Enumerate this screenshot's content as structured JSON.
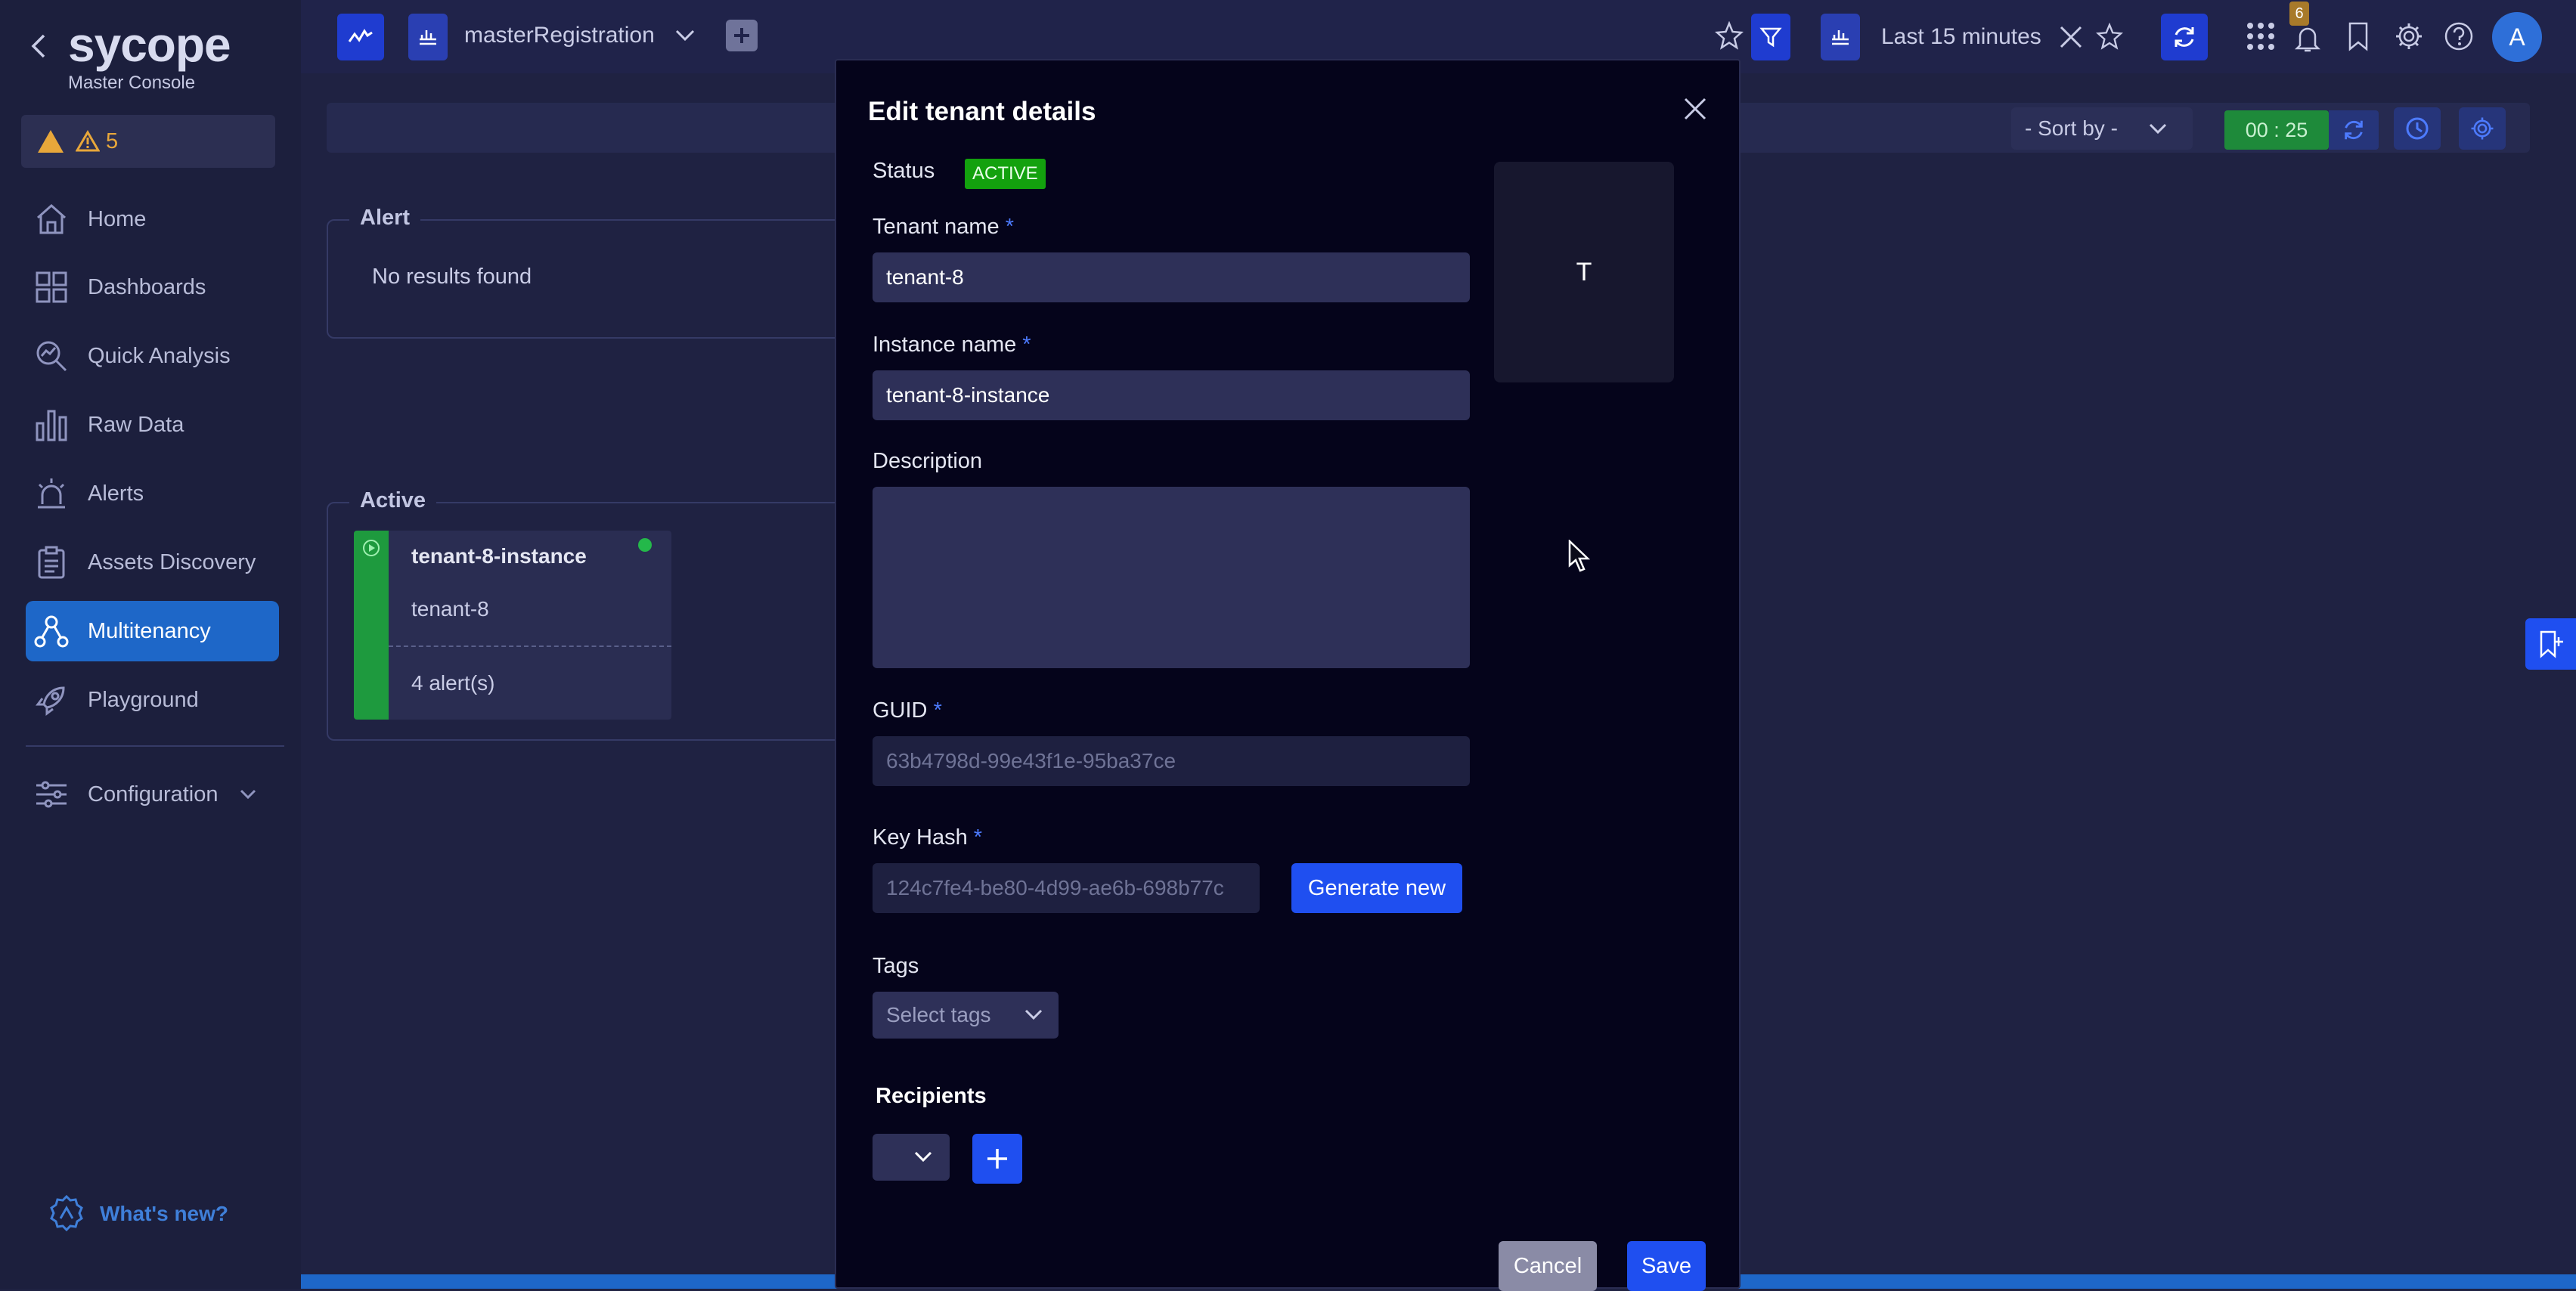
{
  "sidebar": {
    "logo": "sycope",
    "subtitle": "Master Console",
    "alert_count": "5",
    "items": [
      {
        "label": "Home"
      },
      {
        "label": "Dashboards"
      },
      {
        "label": "Quick Analysis"
      },
      {
        "label": "Raw Data"
      },
      {
        "label": "Alerts"
      },
      {
        "label": "Assets Discovery"
      },
      {
        "label": "Multitenancy"
      },
      {
        "label": "Playground"
      }
    ],
    "configuration": "Configuration",
    "whats_new": "What's new?"
  },
  "topbar": {
    "dashboard_name": "masterRegistration",
    "time_range": "Last 15 minutes",
    "notification_badge": "6",
    "avatar_letter": "A"
  },
  "toolbar": {
    "sort_by": "- Sort by -",
    "refresh_timer": "00 : 25"
  },
  "main": {
    "alert_section": {
      "title": "Alert",
      "empty_text": "No results found"
    },
    "active_section": {
      "title": "Active",
      "card": {
        "instance": "tenant-8-instance",
        "tenant": "tenant-8",
        "alerts": "4 alert(s)"
      }
    }
  },
  "modal": {
    "title": "Edit tenant details",
    "status_label": "Status",
    "status_value": "ACTIVE",
    "avatar_letter": "T",
    "tenant_name_label": "Tenant name",
    "tenant_name_value": "tenant-8",
    "instance_name_label": "Instance name",
    "instance_name_value": "tenant-8-instance",
    "description_label": "Description",
    "description_value": "",
    "guid_label": "GUID",
    "guid_value": "63b4798d-99e43f1e-95ba37ce",
    "key_hash_label": "Key Hash",
    "key_hash_value": "124c7fe4-be80-4d99-ae6b-698b77c",
    "generate_label": "Generate new",
    "tags_label": "Tags",
    "tags_placeholder": "Select tags",
    "recipients_label": "Recipients",
    "cancel_label": "Cancel",
    "save_label": "Save",
    "required_mark": "*"
  },
  "colors": {
    "accent": "#1f4ff0",
    "active_nav": "#1e67c8",
    "status_active": "#13a10e",
    "card_green": "#1e9a3e",
    "warning": "#e8a73a"
  }
}
